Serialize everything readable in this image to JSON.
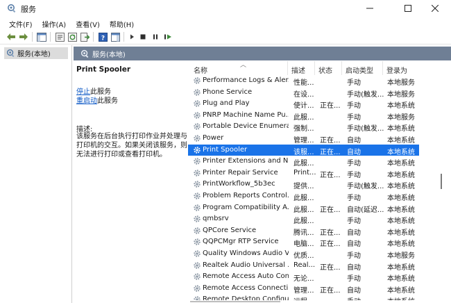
{
  "window": {
    "title": "服务"
  },
  "menu": [
    "文件(F)",
    "操作(A)",
    "查看(V)",
    "帮助(H)"
  ],
  "tree": {
    "item": "服务(本地)"
  },
  "panel": {
    "header": "服务(本地)"
  },
  "detail": {
    "service_name": "Print Spooler",
    "stop_link": "停止",
    "stop_suffix": "此服务",
    "restart_link": "重启动",
    "restart_suffix": "此服务",
    "desc_label": "描述:",
    "description": "该服务在后台执行打印作业并处理与打印机的交互。如果关闭该服务，则无法进行打印或查看打印机。"
  },
  "table": {
    "headers": {
      "name": "名称",
      "desc": "描述",
      "status": "状态",
      "startup": "启动类型",
      "logon": "登录为"
    },
    "rows": [
      {
        "name": "Performance Logs & Aler...",
        "desc": "性能...",
        "status": "",
        "startup": "手动",
        "logon": "本地服务"
      },
      {
        "name": "Phone Service",
        "desc": "在设...",
        "status": "",
        "startup": "手动(触发...",
        "logon": "本地服务"
      },
      {
        "name": "Plug and Play",
        "desc": "使计...",
        "status": "正在...",
        "startup": "手动",
        "logon": "本地系统"
      },
      {
        "name": "PNRP Machine Name Pu...",
        "desc": "此服...",
        "status": "",
        "startup": "手动",
        "logon": "本地服务"
      },
      {
        "name": "Portable Device Enumera...",
        "desc": "强制...",
        "status": "",
        "startup": "手动(触发...",
        "logon": "本地系统"
      },
      {
        "name": "Power",
        "desc": "管理...",
        "status": "正在...",
        "startup": "自动",
        "logon": "本地系统"
      },
      {
        "name": "Print Spooler",
        "desc": "该服...",
        "status": "正在...",
        "startup": "自动",
        "logon": "本地系统",
        "selected": true
      },
      {
        "name": "Printer Extensions and N...",
        "desc": "此服...",
        "status": "",
        "startup": "手动",
        "logon": "本地系统"
      },
      {
        "name": "Printer Repair Service",
        "desc": "Print...",
        "status": "正在...",
        "startup": "手动",
        "logon": "本地系统"
      },
      {
        "name": "PrintWorkflow_5b3ec",
        "desc": "提供...",
        "status": "",
        "startup": "手动(触发...",
        "logon": "本地系统"
      },
      {
        "name": "Problem Reports Control...",
        "desc": "此服...",
        "status": "",
        "startup": "手动",
        "logon": "本地系统"
      },
      {
        "name": "Program Compatibility A...",
        "desc": "此服...",
        "status": "正在...",
        "startup": "自动(延迟...",
        "logon": "本地系统"
      },
      {
        "name": "qmbsrv",
        "desc": "此服...",
        "status": "",
        "startup": "手动",
        "logon": "本地系统"
      },
      {
        "name": "QPCore Service",
        "desc": "腾讯...",
        "status": "正在...",
        "startup": "自动",
        "logon": "本地系统"
      },
      {
        "name": "QQPCMgr RTP Service",
        "desc": "电脑...",
        "status": "正在...",
        "startup": "自动",
        "logon": "本地系统"
      },
      {
        "name": "Quality Windows Audio V...",
        "desc": "优质...",
        "status": "",
        "startup": "手动",
        "logon": "本地服务"
      },
      {
        "name": "Realtek Audio Universal ...",
        "desc": "Real...",
        "status": "正在...",
        "startup": "自动",
        "logon": "本地系统"
      },
      {
        "name": "Remote Access Auto Con...",
        "desc": "无论...",
        "status": "",
        "startup": "手动",
        "logon": "本地系统"
      },
      {
        "name": "Remote Access Connecti...",
        "desc": "管理...",
        "status": "正在...",
        "startup": "自动",
        "logon": "本地系统"
      },
      {
        "name": "Remote Desktop Configu...",
        "desc": "远程...",
        "status": "",
        "startup": "手动",
        "logon": "本地系统"
      }
    ]
  },
  "colors": {
    "selection": "#1a73e8",
    "panel_header": "#6f7f95",
    "link": "#0b57c5"
  }
}
